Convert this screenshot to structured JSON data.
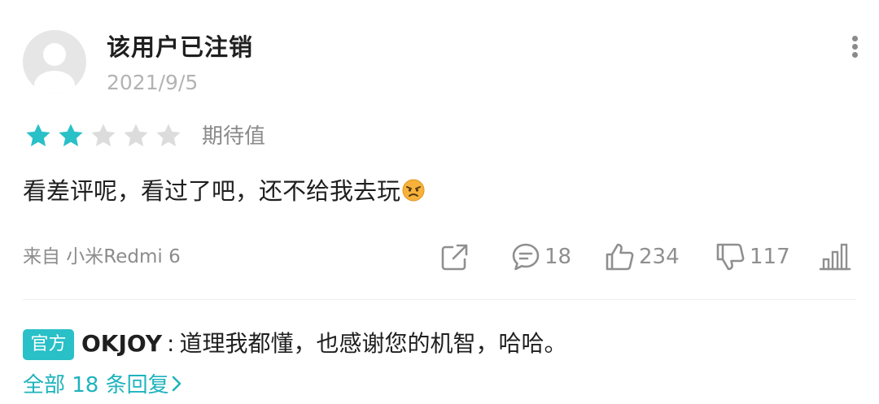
{
  "review": {
    "username": "该用户已注销",
    "date": "2021/9/5",
    "rating": {
      "value": 2,
      "max": 5,
      "label": "期待值"
    },
    "text": "看差评呢，看过了吧，还不给我去玩",
    "emoji": "angry-face-emoji",
    "device": "来自 小米Redmi 6"
  },
  "actions": {
    "share": {
      "icon": "share-icon"
    },
    "comments": {
      "icon": "comment-icon",
      "count": "18"
    },
    "likes": {
      "icon": "thumbs-up-icon",
      "count": "234"
    },
    "dislikes": {
      "icon": "thumbs-down-icon",
      "count": "117"
    },
    "stats": {
      "icon": "bar-chart-icon"
    }
  },
  "reply": {
    "badge": "官方",
    "author": "OKJOY",
    "separator": ":",
    "text": "道理我都懂，也感谢您的机智，哈哈。",
    "all_replies_label": "全部 18 条回复"
  },
  "colors": {
    "accent": "#29c0c8",
    "link": "#1fb3bd",
    "star_filled": "#29c0c8",
    "star_empty": "#dcdcdc",
    "muted_text": "#8c8c8c"
  }
}
